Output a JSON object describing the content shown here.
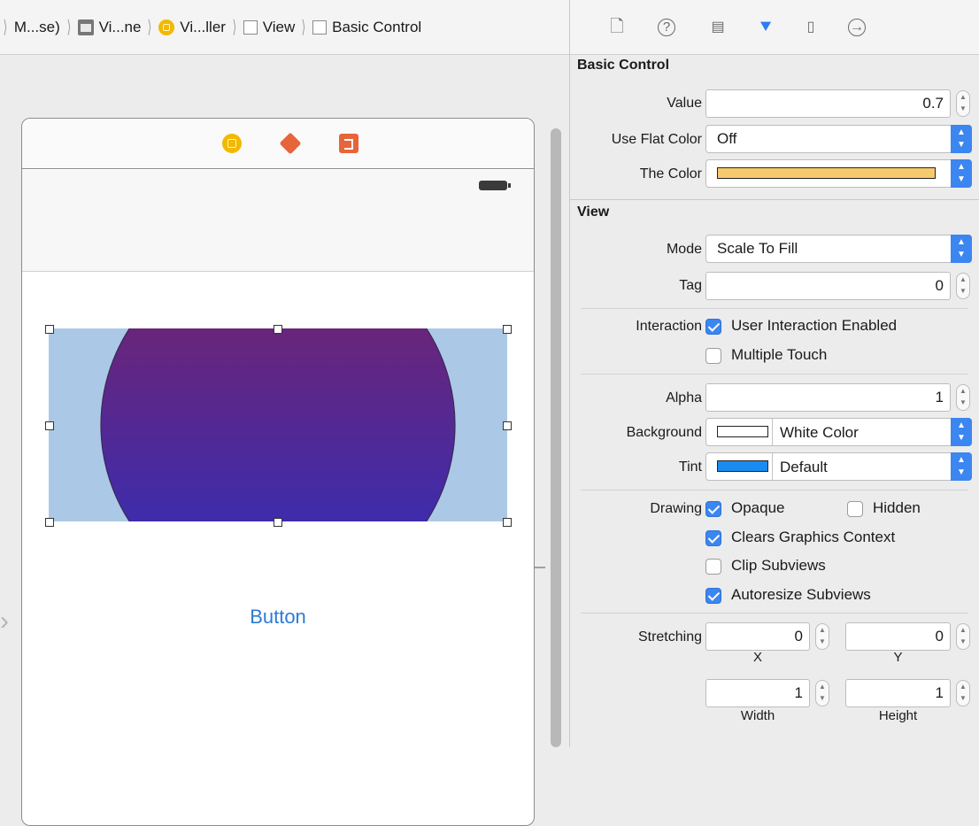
{
  "jumpbar": {
    "crumbs": [
      {
        "label": "M...se)",
        "icon": "none"
      },
      {
        "label": "Vi...ne",
        "icon": "storyboard-scene-icon"
      },
      {
        "label": "Vi...ller",
        "icon": "view-controller-icon"
      },
      {
        "label": "View",
        "icon": "view-icon"
      },
      {
        "label": "Basic Control",
        "icon": "view-icon"
      }
    ]
  },
  "canvas": {
    "button_label": "Button",
    "gradient": {
      "top": "#7b2266",
      "bottom": "#2c2fc0"
    },
    "view_background": "#abc9e6"
  },
  "inspector": {
    "tabs": [
      "file-icon",
      "help-icon",
      "identity-icon",
      "attributes-icon",
      "size-icon",
      "connections-icon"
    ],
    "active_tab": "attributes-icon",
    "basic_control": {
      "title": "Basic Control",
      "value_label": "Value",
      "value": "0.7",
      "flat_label": "Use Flat Color",
      "flat_value": "Off",
      "color_label": "The Color",
      "color_swatch": "#f6c96d"
    },
    "view": {
      "title": "View",
      "mode_label": "Mode",
      "mode_value": "Scale To Fill",
      "tag_label": "Tag",
      "tag_value": "0",
      "interaction_label": "Interaction",
      "user_interaction": "User Interaction Enabled",
      "multiple_touch": "Multiple Touch",
      "alpha_label": "Alpha",
      "alpha_value": "1",
      "background_label": "Background",
      "background_value": "White Color",
      "background_swatch": "#ffffff",
      "tint_label": "Tint",
      "tint_value": "Default",
      "tint_swatch": "#1a8cf0",
      "drawing_label": "Drawing",
      "opaque": "Opaque",
      "hidden": "Hidden",
      "clears": "Clears Graphics Context",
      "clip": "Clip Subviews",
      "autoresize": "Autoresize Subviews",
      "stretching_label": "Stretching",
      "stretch_x": "0",
      "stretch_y": "0",
      "stretch_w": "1",
      "stretch_h": "1",
      "x_caption": "X",
      "y_caption": "Y",
      "w_caption": "Width",
      "h_caption": "Height"
    }
  }
}
